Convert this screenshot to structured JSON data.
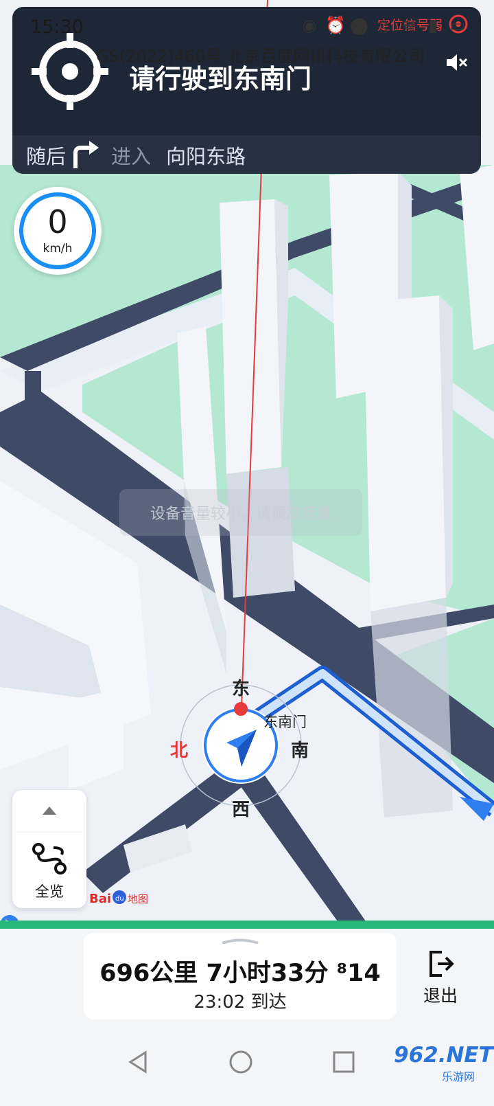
{
  "status_bar": {
    "time": "15:30",
    "icons": [
      "eye-icon",
      "alarm-icon",
      "location-icon",
      "vibrate-icon",
      "wifi-icon",
      "signal-icon",
      "battery-icon"
    ]
  },
  "copyright": "GS(2022)460号 北京百度网讯科技有限公司",
  "guidance": {
    "instruction": "请行驶到东南门",
    "weak_signal": "定位信号弱",
    "then_label": "随后",
    "enter_label": "进入",
    "road_name": "向阳东路"
  },
  "speed": {
    "value": "0",
    "unit": "km/h"
  },
  "toast": "设备音量较小，请调高音量",
  "compass": {
    "east": "东",
    "south": "南",
    "west": "西",
    "north": "北"
  },
  "poi": "东南门",
  "overview": {
    "label": "全览"
  },
  "logo": "Bai都地图",
  "trip": {
    "summary": "696公里 7小时33分 ⁸14",
    "arrival": "23:02 到达",
    "progress_fraction": 0.0
  },
  "exit": {
    "label": "退出"
  },
  "watermark": {
    "main": "962.NET",
    "sub": "乐游网"
  },
  "colors": {
    "panel": "#1e2736",
    "route_blue": "#2f7ff0",
    "park_green": "#b4e8d2",
    "road_dark": "#3e4a66",
    "progress_green": "#28b67a",
    "warning_red": "#e53b3b"
  }
}
